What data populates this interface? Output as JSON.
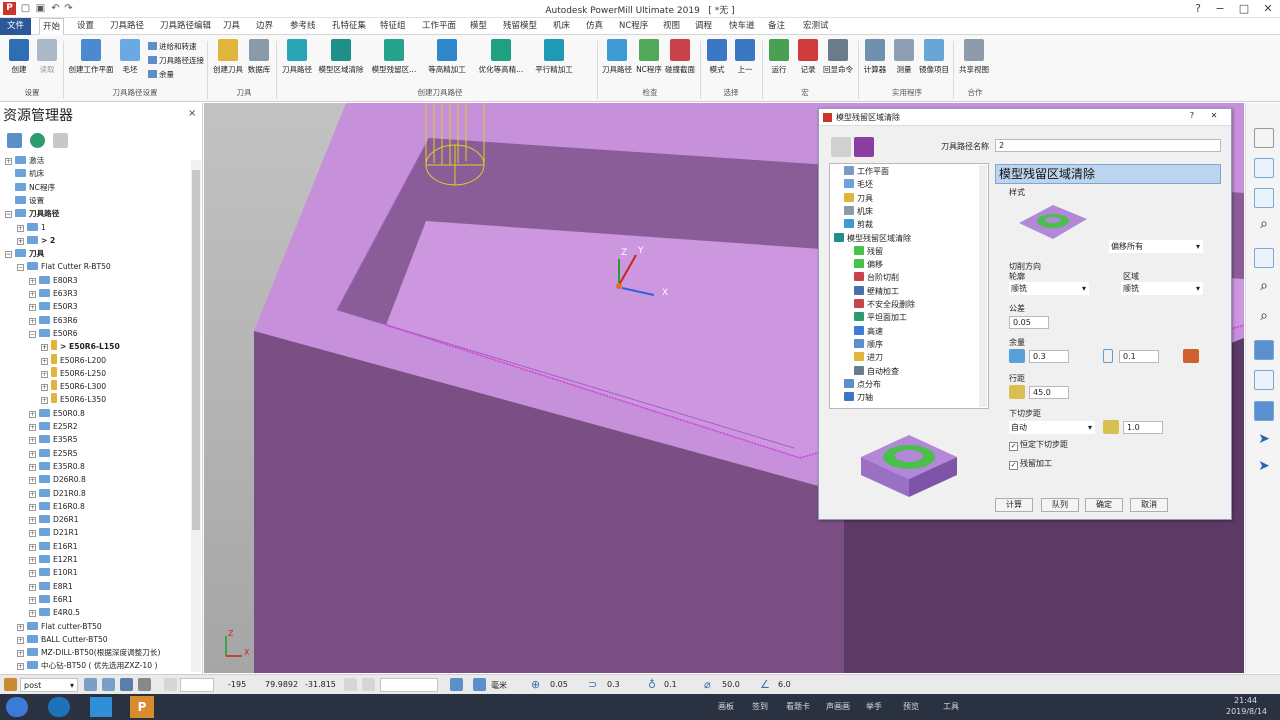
{
  "app": {
    "title": "Autodesk PowerMill Ultimate 2019",
    "doc": "[ *无 ]"
  },
  "window_controls": {
    "help": "?",
    "minimize": "−",
    "restore": "□",
    "close": "✕"
  },
  "menu": [
    "文件",
    "开始",
    "设置",
    "刀具路径",
    "刀具路径编辑",
    "刀具",
    "边界",
    "参考线",
    "孔特征集",
    "特征组",
    "工作平面",
    "模型",
    "残留模型",
    "机床",
    "仿真",
    "NC程序",
    "视图",
    "调程",
    "快车道",
    "备注",
    "宏测试"
  ],
  "ribbon": {
    "buttons": {
      "create": "创建",
      "pick": "读取",
      "create_wp": "创建工作平面",
      "stock": "毛坯",
      "lead_links": "进给和转速",
      "toolpath_connect": "刀具路径连接",
      "allowance": "余量",
      "create_tool": "创建刀具",
      "database": "数据库",
      "toolpath": "刀具路径",
      "model_area_clear": "模型区域清除",
      "model_rest_clear": "模型残留区...",
      "const_z_finish": "等高精加工",
      "opt_const_z": "优化等高精...",
      "parallel_finish": "平行精加工",
      "tp_verify": "刀具路径",
      "nc_verify": "NC程序",
      "collision": "碰撞截面",
      "mode": "模式",
      "up": "上一",
      "run": "运行",
      "record": "记录",
      "echo": "回显命令",
      "calculator": "计算器",
      "measure": "测量",
      "mirror": "镜像项目",
      "share_view": "共享视图"
    },
    "groups": [
      "设置",
      "刀具路径设置",
      "刀具",
      "创建刀具路径",
      "检查",
      "选择",
      "宏",
      "实用程序",
      "合作"
    ]
  },
  "explorer": {
    "title": "资源管理器",
    "close": "×",
    "tree": [
      {
        "label": "激活",
        "level": 0,
        "pm": "+"
      },
      {
        "label": "机床",
        "level": 0,
        "pm": ""
      },
      {
        "label": "NC程序",
        "level": 0,
        "pm": ""
      },
      {
        "label": "设置",
        "level": 0,
        "pm": ""
      },
      {
        "label": "刀具路径",
        "level": 0,
        "pm": "−",
        "bold": true
      },
      {
        "label": "1",
        "level": 1,
        "pm": "+"
      },
      {
        "label": "> 2",
        "level": 1,
        "pm": "+",
        "bold": true
      },
      {
        "label": "刀具",
        "level": 0,
        "pm": "−",
        "bold": true
      },
      {
        "label": "Flat Cutter R-BT50",
        "level": 1,
        "pm": "−"
      },
      {
        "label": "E80R3",
        "level": 2,
        "pm": "+"
      },
      {
        "label": "E63R3",
        "level": 2,
        "pm": "+"
      },
      {
        "label": "E50R3",
        "level": 2,
        "pm": "+"
      },
      {
        "label": "E63R6",
        "level": 2,
        "pm": "+"
      },
      {
        "label": "E50R6",
        "level": 2,
        "pm": "−"
      },
      {
        "label": "> E50R6-L150",
        "level": 3,
        "pm": "+",
        "bold": true
      },
      {
        "label": "E50R6-L200",
        "level": 3,
        "pm": "+"
      },
      {
        "label": "E50R6-L250",
        "level": 3,
        "pm": "+"
      },
      {
        "label": "E50R6-L300",
        "level": 3,
        "pm": "+"
      },
      {
        "label": "E50R6-L350",
        "level": 3,
        "pm": "+"
      },
      {
        "label": "E50R0.8",
        "level": 2,
        "pm": "+"
      },
      {
        "label": "E25R2",
        "level": 2,
        "pm": "+"
      },
      {
        "label": "E35R5",
        "level": 2,
        "pm": "+"
      },
      {
        "label": "E25R5",
        "level": 2,
        "pm": "+"
      },
      {
        "label": "E35R0.8",
        "level": 2,
        "pm": "+"
      },
      {
        "label": "D26R0.8",
        "level": 2,
        "pm": "+"
      },
      {
        "label": "D21R0.8",
        "level": 2,
        "pm": "+"
      },
      {
        "label": "E16R0.8",
        "level": 2,
        "pm": "+"
      },
      {
        "label": "D26R1",
        "level": 2,
        "pm": "+"
      },
      {
        "label": "D21R1",
        "level": 2,
        "pm": "+"
      },
      {
        "label": "E16R1",
        "level": 2,
        "pm": "+"
      },
      {
        "label": "E12R1",
        "level": 2,
        "pm": "+"
      },
      {
        "label": "E10R1",
        "level": 2,
        "pm": "+"
      },
      {
        "label": "E8R1",
        "level": 2,
        "pm": "+"
      },
      {
        "label": "E6R1",
        "level": 2,
        "pm": "+"
      },
      {
        "label": "E4R0.5",
        "level": 2,
        "pm": "+"
      },
      {
        "label": "Flat cutter-BT50",
        "level": 1,
        "pm": "+"
      },
      {
        "label": "BALL Cutter-BT50",
        "level": 1,
        "pm": "+"
      },
      {
        "label": "MZ-DILL-BT50(根据深度调整刀长)",
        "level": 1,
        "pm": "+"
      },
      {
        "label": "中心钻-BT50 ( 优先选用ZXZ-10 )",
        "level": 1,
        "pm": "+"
      }
    ]
  },
  "viewport": {
    "axis_x": "X",
    "axis_y": "Y",
    "axis_z": "Z",
    "tri_x": "X",
    "tri_z": "Z"
  },
  "dialog": {
    "title": "模型残留区域清除",
    "help": "?",
    "close": "✕",
    "name_label": "刀具路径名称",
    "name_value": "2",
    "tree": [
      "工作平面",
      "毛坯",
      "刀具",
      "机床",
      "剪裁",
      "模型残留区域清除",
      "残留",
      "偏移",
      "台阶切削",
      "壁精加工",
      "不安全段删除",
      "平坦面加工",
      "高速",
      "顺序",
      "进刀",
      "自动检查",
      "点分布",
      "刀轴"
    ],
    "header": "模型残留区域清除",
    "style_label": "样式",
    "style_value": "偏移所有",
    "cut_dir_label": "切削方向",
    "profile_label": "轮廓",
    "profile_value": "顺铣",
    "area_label": "区域",
    "area_value": "顺铣",
    "tolerance_label": "公差",
    "tolerance_value": "0.05",
    "allowance_label": "余量",
    "allowance_radial": "0.3",
    "allowance_axial": "0.1",
    "stepover_label": "行距",
    "stepover_value": "45.0",
    "stepdown_label": "下切步距",
    "stepdown_mode": "自动",
    "stepdown_value": "1.0",
    "const_stepdown": "恒定下切步距",
    "rest_machining": "残留加工",
    "buttons": {
      "calc": "计算",
      "queue": "队列",
      "ok": "确定",
      "cancel": "取消"
    }
  },
  "statusbar": {
    "post": "post",
    "coord_x": "-195",
    "coord_y": "79.9892",
    "coord_z": "-31.815",
    "units": "毫米",
    "tolerance": "0.05",
    "allowance": "0.3",
    "axial_allowance": "0.1",
    "diameter": "50.0",
    "angle": "6.0"
  },
  "taskbar": {
    "items": [
      "画板",
      "签到",
      "看题卡",
      "声画画",
      "举手",
      "预览",
      "工具"
    ],
    "time": "21:44",
    "date": "2019/8/14"
  },
  "colors": {
    "model_top": "#c892dc",
    "model_front": "#7a4e82",
    "model_side": "#5a3964",
    "ribbon_accent": "#2b5797",
    "dialog_header": "#bcd4ee"
  }
}
